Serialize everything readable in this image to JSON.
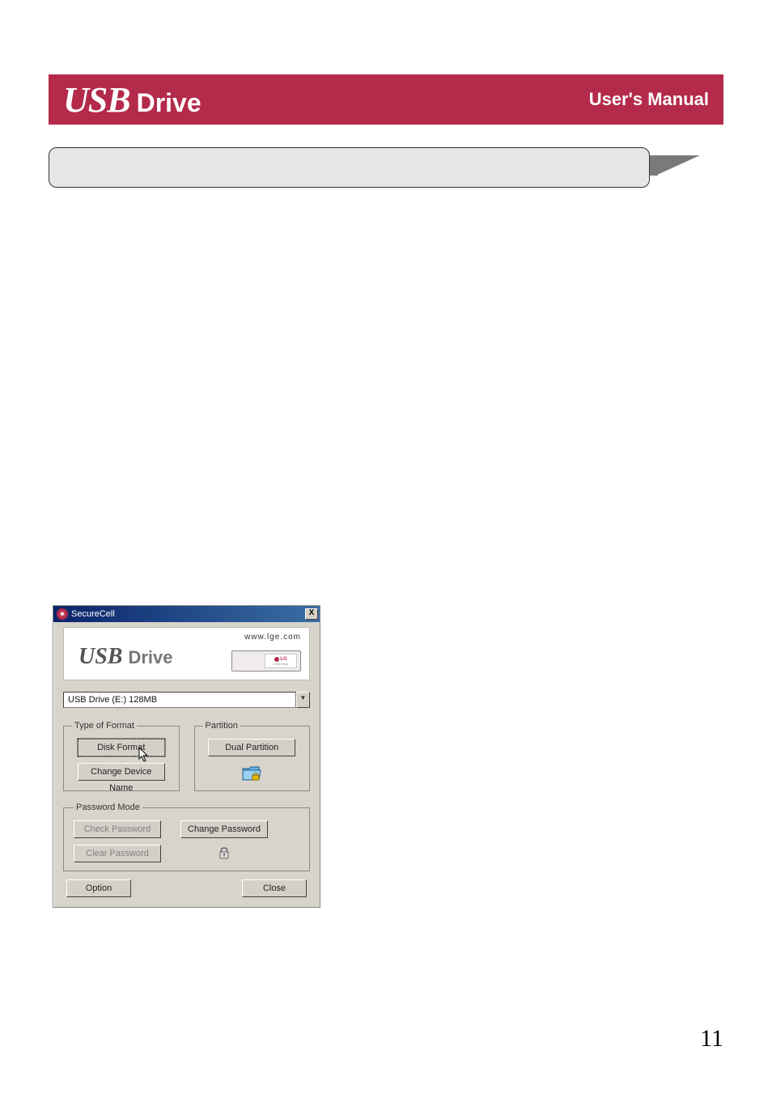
{
  "header": {
    "logo_usb": "USB",
    "logo_drive": "Drive",
    "manual": "User's Manual"
  },
  "page_number": "11",
  "dialog": {
    "title": "SecureCell",
    "close_x": "X",
    "banner": {
      "url": "www.lge.com",
      "logo_usb": "USB",
      "logo_drive": "Drive",
      "lg": "LG",
      "lg_sub": "USB Drive"
    },
    "drive_selected": "USB Drive (E:) 128MB",
    "dropdown_arrow": "▼",
    "format_group": {
      "legend": "Type of Format",
      "disk_format": "Disk Format",
      "change_name": "Change Device Name"
    },
    "partition_group": {
      "legend": "Partition",
      "dual_partition": "Dual Partition"
    },
    "password_group": {
      "legend": "Password Mode",
      "check": "Check Password",
      "change": "Change Password",
      "clear": "Clear Password"
    },
    "option": "Option",
    "close": "Close"
  }
}
